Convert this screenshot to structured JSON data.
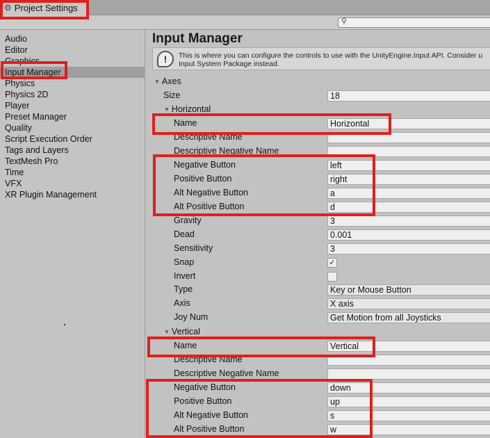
{
  "window": {
    "title": "Project Settings",
    "icon": "gear-icon"
  },
  "search": {
    "placeholder": ""
  },
  "sidebar": {
    "items": [
      {
        "label": "Audio"
      },
      {
        "label": "Editor"
      },
      {
        "label": "Graphics"
      },
      {
        "label": "Input Manager",
        "selected": true
      },
      {
        "label": "Physics"
      },
      {
        "label": "Physics 2D"
      },
      {
        "label": "Player"
      },
      {
        "label": "Preset Manager"
      },
      {
        "label": "Quality"
      },
      {
        "label": "Script Execution Order"
      },
      {
        "label": "Tags and Layers"
      },
      {
        "label": "TextMesh Pro"
      },
      {
        "label": "Time"
      },
      {
        "label": "VFX"
      },
      {
        "label": "XR Plugin Management"
      }
    ]
  },
  "main": {
    "title": "Input Manager",
    "help": {
      "line1": "This is where you can configure the controls to use with the UnityEngine.Input API. Consider u",
      "line2": "Input System Package instead."
    },
    "axes": {
      "label": "Axes",
      "size_label": "Size",
      "size": "18",
      "horizontal": {
        "header": "Horizontal",
        "name_label": "Name",
        "name": "Horizontal",
        "desc_label": "Descriptive Name",
        "desc": "",
        "desc_neg_label": "Descriptive Negative Name",
        "desc_neg": "",
        "neg_label": "Negative Button",
        "neg": "left",
        "pos_label": "Positive Button",
        "pos": "right",
        "alt_neg_label": "Alt Negative Button",
        "alt_neg": "a",
        "alt_pos_label": "Alt Positive Button",
        "alt_pos": "d",
        "gravity_label": "Gravity",
        "gravity": "3",
        "dead_label": "Dead",
        "dead": "0.001",
        "sens_label": "Sensitivity",
        "sens": "3",
        "snap_label": "Snap",
        "snap": true,
        "snap_mark": "✓",
        "invert_label": "Invert",
        "invert": false,
        "type_label": "Type",
        "type": "Key or Mouse Button",
        "axis_label": "Axis",
        "axis": "X axis",
        "joy_label": "Joy Num",
        "joy": "Get Motion from all Joysticks"
      },
      "vertical": {
        "header": "Vertical",
        "name_label": "Name",
        "name": "Vertical",
        "desc_label": "Descriptive Name",
        "desc": "",
        "desc_neg_label": "Descriptive Negative Name",
        "desc_neg": "",
        "neg_label": "Negative Button",
        "neg": "down",
        "pos_label": "Positive Button",
        "pos": "up",
        "alt_neg_label": "Alt Negative Button",
        "alt_neg": "s",
        "alt_pos_label": "Alt Positive Button",
        "alt_pos": "w"
      }
    }
  },
  "colors": {
    "highlight": "#e0201c",
    "selection": "#9e9e9e",
    "background": "#c2c2c2"
  }
}
